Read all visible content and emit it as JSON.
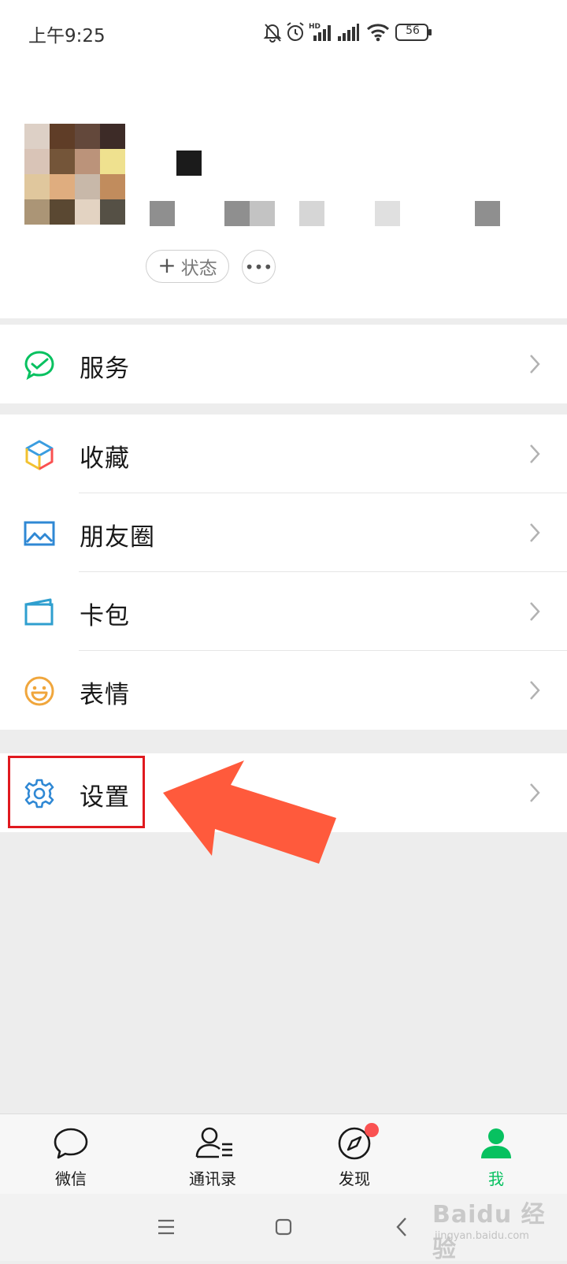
{
  "status_bar": {
    "time": "上午9:25",
    "battery": "56"
  },
  "profile": {
    "status_button_label": "状态",
    "avatar_colors": [
      "#ddd0c6",
      "#5f3d27",
      "#63483b",
      "#3d2b27",
      "#d9c4b7",
      "#745539",
      "#bb937a",
      "#efe18f",
      "#e0c79d",
      "#dfad7f",
      "#c8b8a9",
      "#c18c5d",
      "#ab9576",
      "#5a4832",
      "#e3d3c2",
      "#555045"
    ],
    "wxid_blocks": [
      {
        "color": "#8f8f8f"
      },
      {
        "color": "#8f8f8f"
      },
      {
        "color": "#c3c3c3"
      },
      {
        "color": "#d6d6d6"
      },
      {
        "color": "#e0e0e0"
      },
      {
        "color": "#8f8f8f"
      }
    ]
  },
  "menu": {
    "service": "服务",
    "favorites": "收藏",
    "moments": "朋友圈",
    "cards": "卡包",
    "stickers": "表情",
    "settings": "设置"
  },
  "tabs": {
    "chats": "微信",
    "contacts": "通讯录",
    "discover": "发现",
    "me": "我"
  },
  "colors": {
    "accent": "#07c160",
    "highlight": "#e0191f",
    "arrow": "#ff5a3c",
    "badge": "#fa5151"
  },
  "watermark": {
    "brand": "Baidu 经验",
    "url": "jingyan.baidu.com"
  }
}
